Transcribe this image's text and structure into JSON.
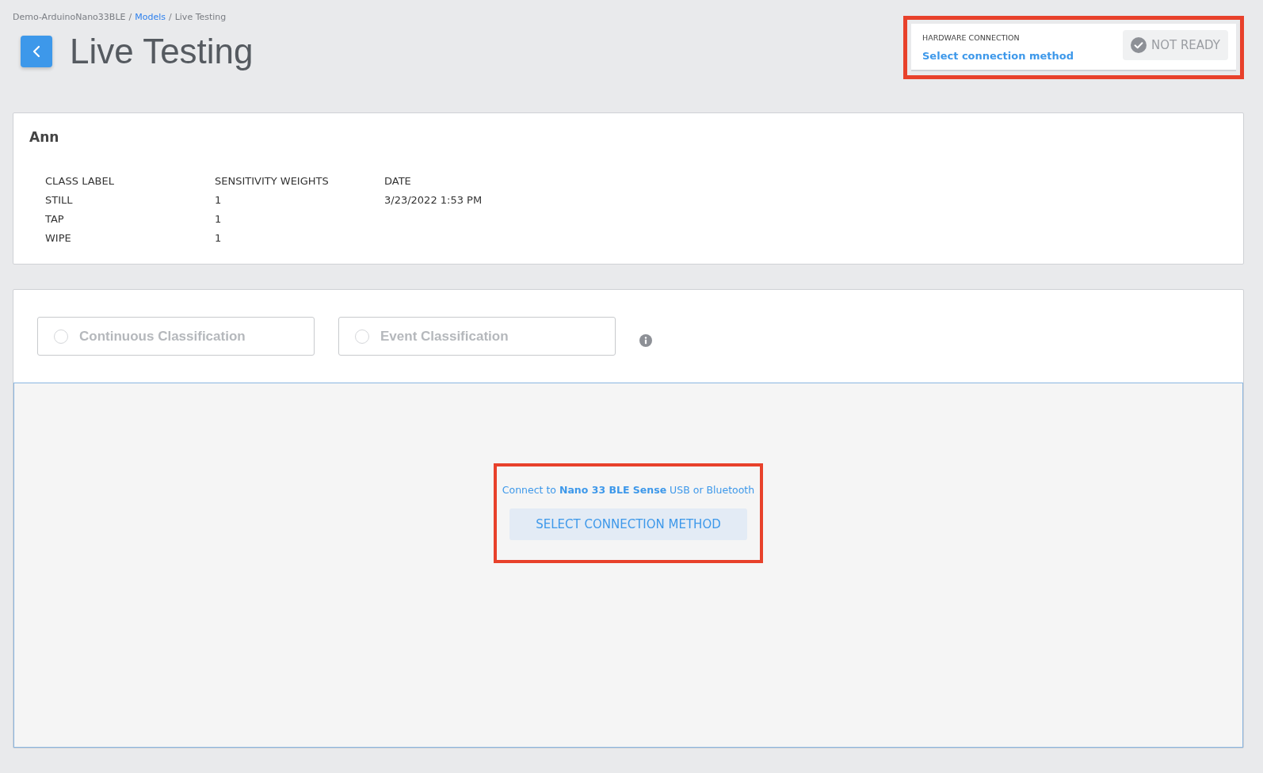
{
  "breadcrumb": [
    {
      "label": "Demo-ArduinoNano33BLE",
      "link": false
    },
    {
      "label": "Models",
      "link": true
    },
    {
      "label": "Live Testing",
      "link": false
    }
  ],
  "breadcrumb_separator": "/",
  "page_title": "Live Testing",
  "hardware_connection": {
    "heading": "HARDWARE CONNECTION",
    "link": "Select connection method",
    "status": "NOT READY",
    "ready": false,
    "highlighted": true
  },
  "model": {
    "name": "Ann",
    "columns": [
      "CLASS LABEL",
      "SENSITIVITY WEIGHTS",
      "DATE"
    ],
    "rows": [
      [
        "STILL",
        "1",
        "3/23/2022 1:53 PM"
      ],
      [
        "TAP",
        "1",
        ""
      ],
      [
        "WIPE",
        "1",
        ""
      ]
    ]
  },
  "classification_modes": [
    {
      "label": "Continuous Classification",
      "selected": false,
      "disabled": true
    },
    {
      "label": "Event Classification",
      "selected": false,
      "disabled": true
    }
  ],
  "connect_prompt": {
    "message": "Connect to **Nano 33 BLE Sense** USB or Bluetooth",
    "button": "SELECT CONNECTION METHOD",
    "highlighted": true
  }
}
